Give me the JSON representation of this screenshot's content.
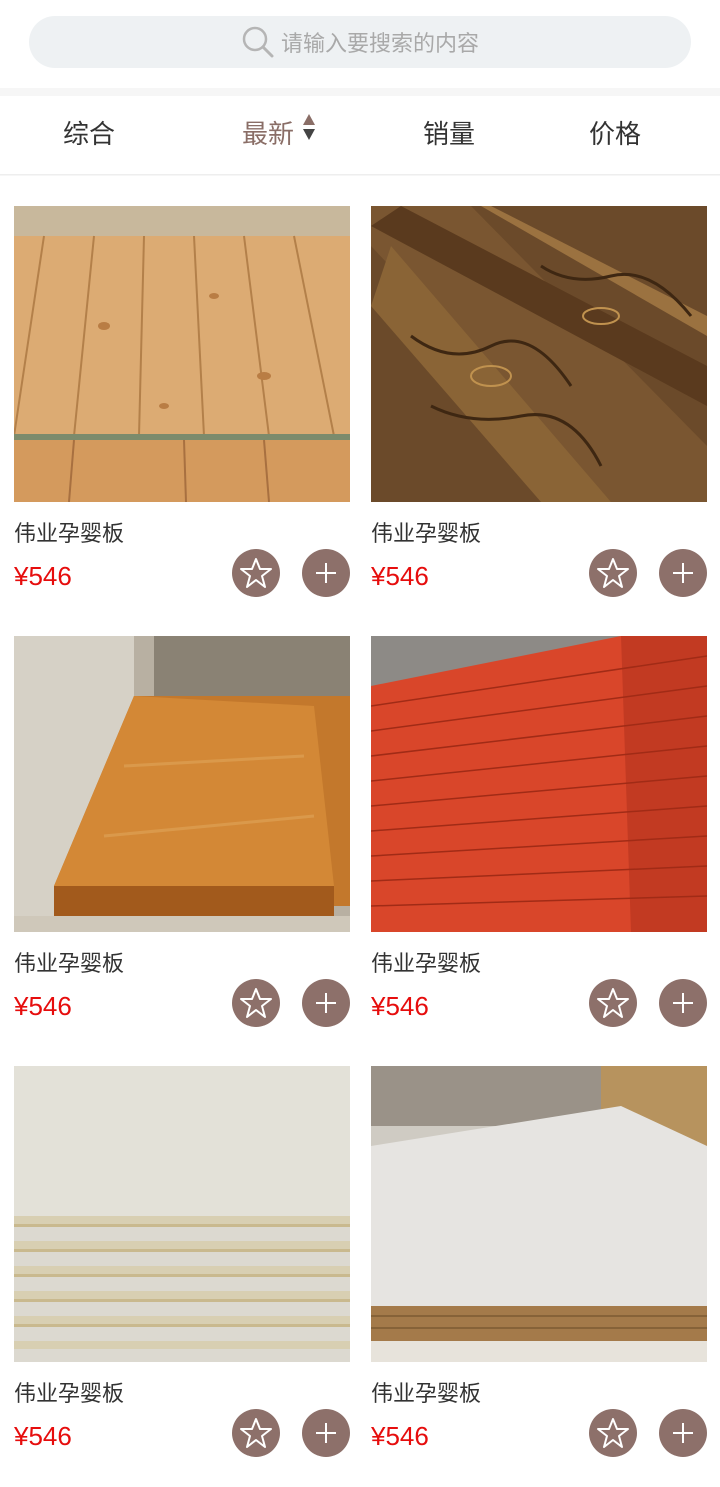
{
  "search": {
    "placeholder": "请输入要搜索的内容"
  },
  "tabs": [
    {
      "label": "综合",
      "active": false
    },
    {
      "label": "最新",
      "active": true
    },
    {
      "label": "销量",
      "active": false
    },
    {
      "label": "价格",
      "active": false
    }
  ],
  "colors": {
    "accent": "#8d706a",
    "price": "#e60d0d",
    "active_tab": "#8a6e67"
  },
  "products": [
    {
      "name": "伟业孕婴板",
      "price": "¥546",
      "image": "light pine planks"
    },
    {
      "name": "伟业孕婴板",
      "price": "¥546",
      "image": "dark charred wood boards"
    },
    {
      "name": "伟业孕婴板",
      "price": "¥546",
      "image": "varnished wood tabletop"
    },
    {
      "name": "伟业孕婴板",
      "price": "¥546",
      "image": "red plywood stack"
    },
    {
      "name": "伟业孕婴板",
      "price": "¥546",
      "image": "white particle board stack"
    },
    {
      "name": "伟业孕婴板",
      "price": "¥546",
      "image": "white plywood sheet"
    }
  ],
  "icons": {
    "search": "search-icon",
    "favorite": "star-icon",
    "add": "plus-icon",
    "sort": "sort-arrows-icon"
  }
}
